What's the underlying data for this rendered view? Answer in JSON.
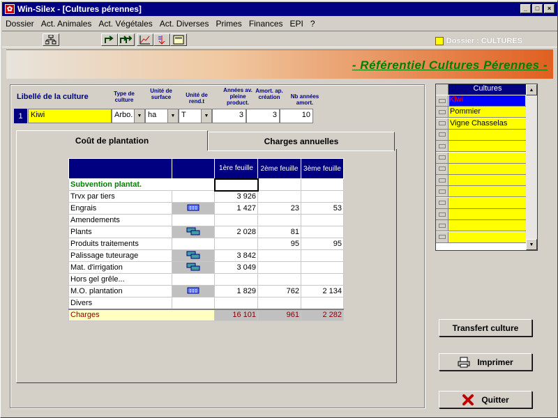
{
  "window": {
    "title": "Win-Silex - [Cultures pérennes]"
  },
  "menu": [
    "Dossier",
    "Act. Animales",
    "Act. Végétales",
    "Act. Diverses",
    "Primes",
    "Finances",
    "EPI",
    "?"
  ],
  "dossier_label": "Dossier : CULTURES",
  "banner_title": "- Référentiel Cultures Pérennes -",
  "header": {
    "libelle": "Libellé de la culture",
    "type": "Type de culture",
    "unite_surface": "Unité de surface",
    "unite_rend": "Unité de rend.t",
    "annees_prod": "Années av. pleine product.",
    "amort_creation": "Amort. ap. création",
    "nb_annees": "Nb années amort."
  },
  "culture": {
    "row_num": "1",
    "name": "Kiwi",
    "type": "Arbo.",
    "surface_unit": "ha",
    "rend_unit": "T",
    "years_before_prod": "3",
    "amort_after": "3",
    "amort_years": "10"
  },
  "tabs": {
    "active": "Coût de plantation",
    "other": "Charges annuelles"
  },
  "grid": {
    "col1": "1ère feuille",
    "col2": "2ème feuille",
    "col3": "3ème feuille",
    "subvention": "Subvention plantat.",
    "rows": [
      {
        "label": "Trvx par tiers",
        "icon": "",
        "v1": "3 926",
        "v2": "",
        "v3": ""
      },
      {
        "label": "Engrais",
        "icon": "calc",
        "v1": "1 427",
        "v2": "23",
        "v3": "53"
      },
      {
        "label": "Amendements",
        "icon": "",
        "v1": "",
        "v2": "",
        "v3": ""
      },
      {
        "label": "Plants",
        "icon": "link",
        "v1": "2 028",
        "v2": "81",
        "v3": ""
      },
      {
        "label": "Produits traitements",
        "icon": "",
        "v1": "",
        "v2": "95",
        "v3": "95"
      },
      {
        "label": "Palissage tuteurage",
        "icon": "link",
        "v1": "3 842",
        "v2": "",
        "v3": ""
      },
      {
        "label": "Mat. d'irrigation",
        "icon": "link",
        "v1": "3 049",
        "v2": "",
        "v3": ""
      },
      {
        "label": "Hors gel grêle...",
        "icon": "",
        "v1": "",
        "v2": "",
        "v3": ""
      },
      {
        "label": "M.O. plantation",
        "icon": "calc",
        "v1": "1 829",
        "v2": "762",
        "v3": "2 134"
      },
      {
        "label": "Divers",
        "icon": "",
        "v1": "",
        "v2": "",
        "v3": ""
      }
    ],
    "charges": {
      "label": "Charges",
      "v1": "16 101",
      "v2": "961",
      "v3": "2 282"
    }
  },
  "cultures_list": {
    "header": "Cultures",
    "items": [
      "Kiwi",
      "Pommier",
      "Vigne Chasselas",
      "",
      "",
      "",
      "",
      "",
      "",
      "",
      "",
      "",
      ""
    ]
  },
  "buttons": {
    "transfert": "Transfert culture",
    "imprimer": "Imprimer",
    "quitter": "Quitter"
  }
}
